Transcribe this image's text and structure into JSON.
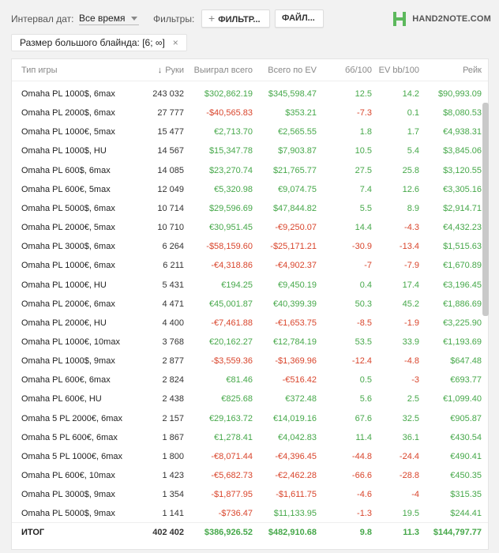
{
  "toolbar": {
    "interval_label": "Интервал дат:",
    "interval_value": "Все время",
    "filters_label": "Фильтры:",
    "filter_button": "ФИЛЬТР...",
    "file_button": "ФАЙЛ...",
    "logo_text": "HAND2NOTE.COM"
  },
  "active_filter": {
    "label": "Размер большого блайнда: [6; ∞]",
    "remove": "×"
  },
  "table": {
    "headers": [
      "Тип игры",
      "Руки",
      "Выиграл всего",
      "Всего по EV",
      "бб/100",
      "EV bb/100",
      "Рейк"
    ],
    "rows": [
      [
        "Omaha PL 1000$, 6max",
        "243 032",
        "$302,862.19",
        "$345,598.47",
        "12.5",
        "14.2",
        "$90,993.09"
      ],
      [
        "Omaha PL 2000$, 6max",
        "27 777",
        "-$40,565.83",
        "$353.21",
        "-7.3",
        "0.1",
        "$8,080.53"
      ],
      [
        "Omaha PL 1000€, 5max",
        "15 477",
        "€2,713.70",
        "€2,565.55",
        "1.8",
        "1.7",
        "€4,938.31"
      ],
      [
        "Omaha PL 1000$, HU",
        "14 567",
        "$15,347.78",
        "$7,903.87",
        "10.5",
        "5.4",
        "$3,845.06"
      ],
      [
        "Omaha PL 600$, 6max",
        "14 085",
        "$23,270.74",
        "$21,765.77",
        "27.5",
        "25.8",
        "$3,120.55"
      ],
      [
        "Omaha PL 600€, 5max",
        "12 049",
        "€5,320.98",
        "€9,074.75",
        "7.4",
        "12.6",
        "€3,305.16"
      ],
      [
        "Omaha PL 5000$, 6max",
        "10 714",
        "$29,596.69",
        "$47,844.82",
        "5.5",
        "8.9",
        "$2,914.71"
      ],
      [
        "Omaha PL 2000€, 5max",
        "10 710",
        "€30,951.45",
        "-€9,250.07",
        "14.4",
        "-4.3",
        "€4,432.23"
      ],
      [
        "Omaha PL 3000$, 6max",
        "6 264",
        "-$58,159.60",
        "-$25,171.21",
        "-30.9",
        "-13.4",
        "$1,515.63"
      ],
      [
        "Omaha PL 1000€, 6max",
        "6 211",
        "-€4,318.86",
        "-€4,902.37",
        "-7",
        "-7.9",
        "€1,670.89"
      ],
      [
        "Omaha PL 1000€, HU",
        "5 431",
        "€194.25",
        "€9,450.19",
        "0.4",
        "17.4",
        "€3,196.45"
      ],
      [
        "Omaha PL 2000€, 6max",
        "4 471",
        "€45,001.87",
        "€40,399.39",
        "50.3",
        "45.2",
        "€1,886.69"
      ],
      [
        "Omaha PL 2000€, HU",
        "4 400",
        "-€7,461.88",
        "-€1,653.75",
        "-8.5",
        "-1.9",
        "€3,225.90"
      ],
      [
        "Omaha PL 1000€, 10max",
        "3 768",
        "€20,162.27",
        "€12,784.19",
        "53.5",
        "33.9",
        "€1,193.69"
      ],
      [
        "Omaha PL 1000$, 9max",
        "2 877",
        "-$3,559.36",
        "-$1,369.96",
        "-12.4",
        "-4.8",
        "$647.48"
      ],
      [
        "Omaha PL 600€, 6max",
        "2 824",
        "€81.46",
        "-€516.42",
        "0.5",
        "-3",
        "€693.77"
      ],
      [
        "Omaha PL 600€, HU",
        "2 438",
        "€825.68",
        "€372.48",
        "5.6",
        "2.5",
        "€1,099.40"
      ],
      [
        "Omaha 5 PL 2000€, 6max",
        "2 157",
        "€29,163.72",
        "€14,019.16",
        "67.6",
        "32.5",
        "€905.87"
      ],
      [
        "Omaha 5 PL 600€, 6max",
        "1 867",
        "€1,278.41",
        "€4,042.83",
        "11.4",
        "36.1",
        "€430.54"
      ],
      [
        "Omaha 5 PL 1000€, 6max",
        "1 800",
        "-€8,071.44",
        "-€4,396.45",
        "-44.8",
        "-24.4",
        "€490.41"
      ],
      [
        "Omaha PL 600€, 10max",
        "1 423",
        "-€5,682.73",
        "-€2,462.28",
        "-66.6",
        "-28.8",
        "€450.35"
      ],
      [
        "Omaha PL 3000$, 9max",
        "1 354",
        "-$1,877.95",
        "-$1,611.75",
        "-4.6",
        "-4",
        "$315.35"
      ],
      [
        "Omaha PL 5000$, 9max",
        "1 141",
        "-$736.47",
        "$11,133.95",
        "-1.3",
        "19.5",
        "$244.41"
      ]
    ],
    "total": [
      "ИТОГ",
      "402 402",
      "$386,926.52",
      "$482,910.68",
      "9.8",
      "11.3",
      "$144,797.77"
    ]
  },
  "colors": {
    "positive": "#46a84a",
    "negative": "#d9452c",
    "accent": "#5cb85c"
  }
}
